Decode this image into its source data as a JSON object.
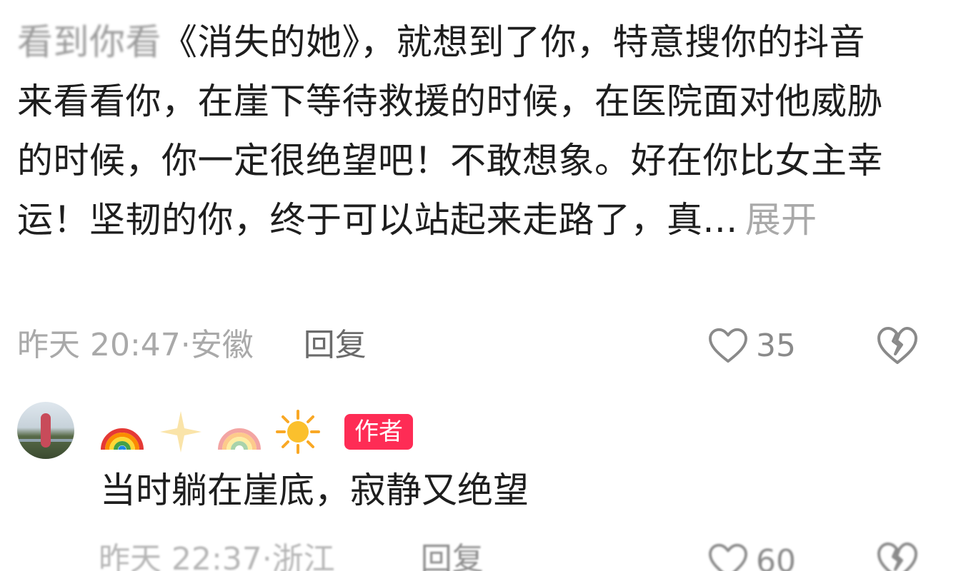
{
  "comment1": {
    "blurred_prefix": "看到你看",
    "body": "《消失的她》，就想到了你，特意搜你的抖音来看看你，在崖下等待救援的时候，在医院面对他威胁的时候，你一定很绝望吧！不敢想象。好在你比女主幸运！坚韧的你，终于可以站起来走路了，真...",
    "expand_label": "展开",
    "timestamp": "昨天 20:47",
    "location": "安徽",
    "reply_label": "回复",
    "like_count": "35"
  },
  "reply": {
    "author_badge": "作者",
    "name_emojis": [
      "rainbow-icon",
      "sparkle-icon",
      "rainbow-icon",
      "sun-icon"
    ],
    "body": "当时躺在崖底，寂静又绝望",
    "timestamp": "昨天 22:37",
    "location": "浙江",
    "reply_label": "回复",
    "like_count": "60"
  },
  "colors": {
    "badge": "#fe2c55",
    "text": "#1e1e1e",
    "meta": "#a9a9a9"
  }
}
